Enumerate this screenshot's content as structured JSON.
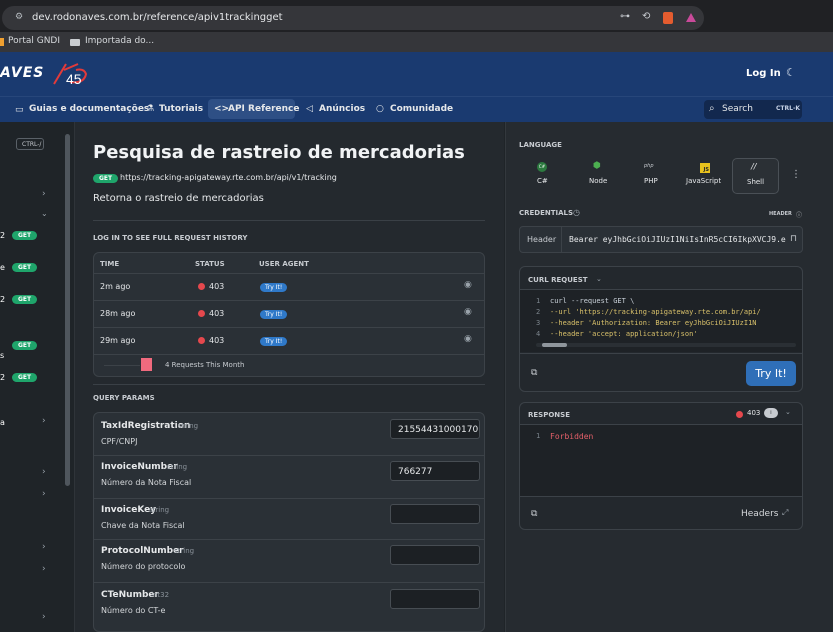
{
  "browser": {
    "url": "dev.rodonaves.com.br/reference/apiv1trackingget",
    "bookmarks": [
      "Portal GNDI",
      "Importada do..."
    ]
  },
  "brand": {
    "logo": "AVES",
    "login": "Log In"
  },
  "nav": {
    "items": [
      "Guias e documentações",
      "Tutoriais",
      "API Reference",
      "Anúncios",
      "Comunidade"
    ],
    "search": "Search",
    "shortcut": "CTRL-K"
  },
  "leftnav": {
    "shortcut": "CTRL-/",
    "method": "GET"
  },
  "page": {
    "title": "Pesquisa de rastreio de mercadorias",
    "method": "GET",
    "url": "https://tracking-apigateway.rte.com.br/api/v1/tracking",
    "description": "Retorna o rastreio de mercadorias"
  },
  "history": {
    "heading": "LOG IN TO SEE FULL REQUEST HISTORY",
    "cols": [
      "TIME",
      "STATUS",
      "USER AGENT"
    ],
    "rows": [
      {
        "time": "2m ago",
        "status": "403",
        "agent": "Try It!"
      },
      {
        "time": "28m ago",
        "status": "403",
        "agent": "Try It!"
      },
      {
        "time": "29m ago",
        "status": "403",
        "agent": "Try It!"
      }
    ],
    "summary": "4 Requests This Month"
  },
  "query": {
    "heading": "QUERY PARAMS",
    "params": [
      {
        "name": "TaxIdRegistration",
        "type": "string",
        "desc": "CPF/CNPJ",
        "value": "21554431000170"
      },
      {
        "name": "InvoiceNumber",
        "type": "string",
        "desc": "Número da Nota Fiscal",
        "value": "766277"
      },
      {
        "name": "InvoiceKey",
        "type": "string",
        "desc": "Chave da Nota Fiscal",
        "value": ""
      },
      {
        "name": "ProtocolNumber",
        "type": "string",
        "desc": "Número do protocolo",
        "value": ""
      },
      {
        "name": "CTeNumber",
        "type": "int32",
        "desc": "Número do CT-e",
        "value": ""
      }
    ]
  },
  "language": {
    "heading": "LANGUAGE",
    "items": [
      {
        "label": "C#",
        "icon": "C#"
      },
      {
        "label": "Node",
        "icon": "⬢"
      },
      {
        "label": "PHP",
        "icon": "php"
      },
      {
        "label": "JavaScript",
        "icon": "JS"
      },
      {
        "label": "Shell",
        "icon": "//"
      }
    ]
  },
  "credentials": {
    "heading": "CREDENTIALS",
    "header_label": "HEADER",
    "key": "Header",
    "value": "Bearer eyJhbGciOiJIUzI1NiIsInR5cCI6IkpXVCJ9.e"
  },
  "curl": {
    "heading": "CURL REQUEST",
    "lines": [
      "curl --request GET \\",
      "     --url 'https://tracking-apigateway.rte.com.br/api/",
      "     --header 'Authorization: Bearer eyJhbGciOiJIUzI1N",
      "     --header 'accept: application/json'"
    ],
    "button": "Try It!"
  },
  "response": {
    "heading": "RESPONSE",
    "status": "403",
    "badge": "i",
    "body": "Forbidden",
    "headers": "Headers"
  }
}
